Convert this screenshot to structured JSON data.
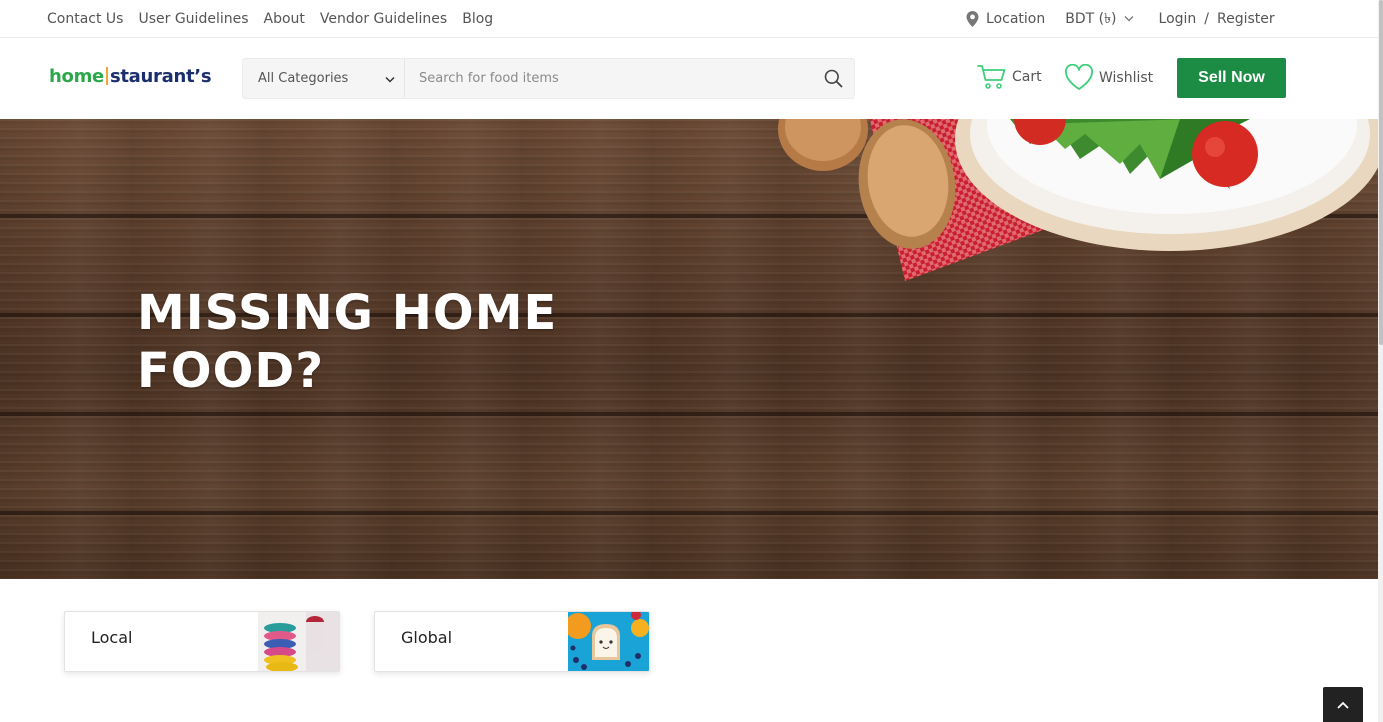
{
  "topbar": {
    "links": [
      "Contact Us",
      "User Guidelines",
      "About",
      "Vendor Guidelines",
      "Blog"
    ],
    "location_label": "Location",
    "currency_label": "BDT (৳)",
    "login_label": "Login",
    "auth_separator": "/",
    "register_label": "Register"
  },
  "header": {
    "logo": {
      "part1": "home",
      "part2": "staurant’s"
    },
    "search": {
      "category_selected": "All Categories",
      "placeholder": "Search for food items",
      "value": ""
    },
    "cart_label": "Cart",
    "wishlist_label": "Wishlist",
    "sell_label": "Sell Now"
  },
  "hero": {
    "title": "MISSING HOME FOOD?"
  },
  "categories": [
    {
      "label": "Local"
    },
    {
      "label": "Global"
    }
  ],
  "colors": {
    "brand_green": "#1c8c45",
    "icon_green": "#3ccf7a",
    "logo_green": "#2aa84a",
    "logo_navy": "#1b2f6e",
    "scroll_top_bg": "#222222"
  },
  "icons": {
    "location": "map-pin-icon",
    "currency_dropdown": "chevron-down-icon",
    "category_dropdown": "chevron-down-icon",
    "search": "search-icon",
    "cart": "cart-icon",
    "wishlist": "heart-icon",
    "scroll_top": "chevron-up-icon"
  }
}
